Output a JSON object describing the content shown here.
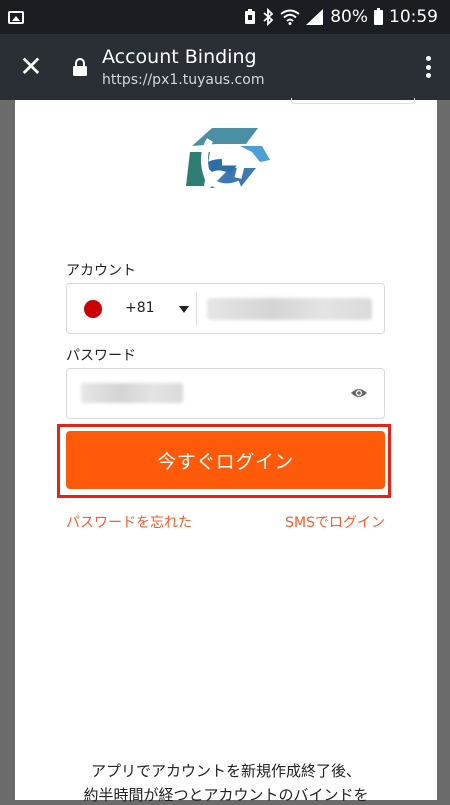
{
  "status_bar": {
    "battery_percent": "80%",
    "time": "10:59"
  },
  "app_bar": {
    "title": "Account Binding",
    "url": "https://px1.tuyaus.com"
  },
  "form": {
    "account_label": "アカウント",
    "country_code": "+81",
    "password_label": "パスワード",
    "login_button": "今すぐログイン",
    "forgot_password_link": "パスワードを忘れた",
    "sms_login_link": "SMSでログイン"
  },
  "notice": {
    "line1": "アプリでアカウントを新規作成終了後、",
    "line2": "約半時間が経つとアカウントのバインドを"
  },
  "colors": {
    "accent": "#ff5a0a",
    "highlight": "#e4231b",
    "appbar": "#2a2f36"
  }
}
